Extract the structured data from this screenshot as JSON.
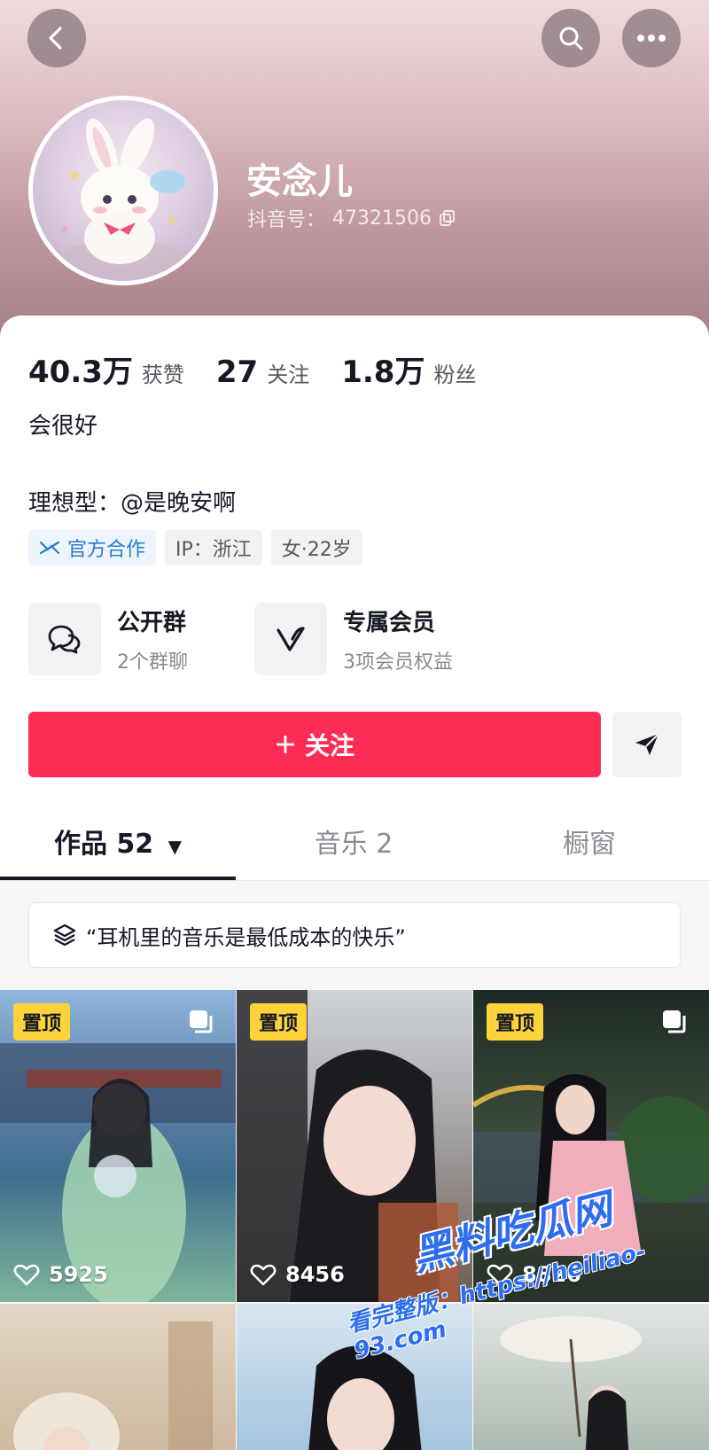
{
  "profile": {
    "nickname": "安念儿",
    "douyin_id_label": "抖音号：",
    "douyin_id": "47321506",
    "bio": "会很好",
    "ideal_type": "理想型：@是晚安啊"
  },
  "stats": [
    {
      "value": "40.3万",
      "label": "获赞"
    },
    {
      "value": "27",
      "label": "关注"
    },
    {
      "value": "1.8万",
      "label": "粉丝"
    }
  ],
  "tags": {
    "official": "官方合作",
    "ip": "IP：浙江",
    "gender_age": "女·22岁"
  },
  "features": [
    {
      "title": "公开群",
      "subtitle": "2个群聊",
      "icon": "chat-bubbles-icon"
    },
    {
      "title": "专属会员",
      "subtitle": "3项会员权益",
      "icon": "v-member-icon"
    }
  ],
  "actions": {
    "follow_label": "关注"
  },
  "tabs": [
    {
      "label": "作品 52",
      "active": true
    },
    {
      "label": "音乐 2",
      "active": false
    },
    {
      "label": "橱窗",
      "active": false
    }
  ],
  "collection": {
    "title": "“耳机里的音乐是最低成本的快乐”"
  },
  "videos": [
    {
      "pinned": "置顶",
      "likes": "5925"
    },
    {
      "pinned": "置顶",
      "likes": "8456"
    },
    {
      "pinned": "置顶",
      "likes": "8826"
    },
    {
      "pinned": "",
      "likes": ""
    },
    {
      "pinned": "",
      "likes": ""
    },
    {
      "pinned": "",
      "likes": ""
    }
  ],
  "watermark": {
    "brand": "黑料吃瓜网",
    "line": "看完整版：https://heiliao-93.com"
  },
  "colors": {
    "accent": "#fe2c55",
    "pin_badge": "#fcd33a",
    "official_blue": "#2a7ccb"
  }
}
